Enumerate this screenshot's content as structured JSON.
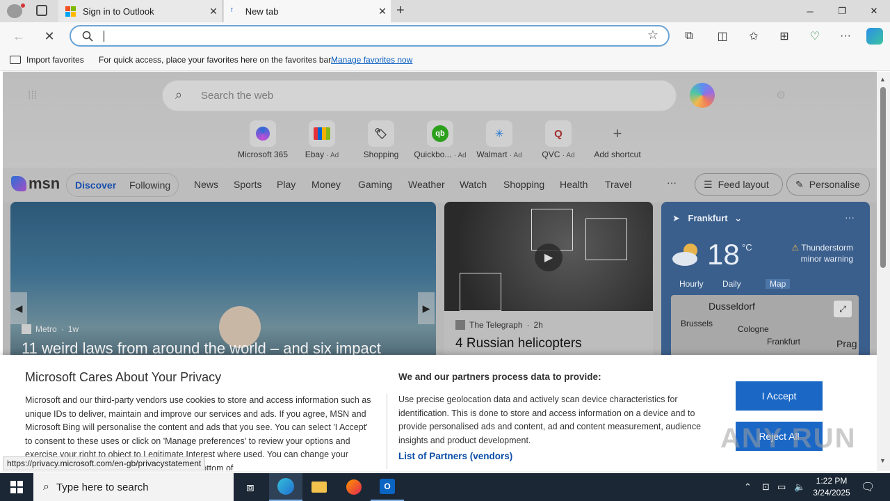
{
  "browser": {
    "tabs": [
      {
        "title": "Sign in to Outlook",
        "active": false
      },
      {
        "title": "New tab",
        "active": true
      }
    ],
    "address": {
      "value": "",
      "placeholder": ""
    },
    "favorites_bar": {
      "import_label": "Import favorites",
      "message": "For quick access, place your favorites here on the favorites bar.",
      "manage_link": "Manage favorites now"
    }
  },
  "newtab": {
    "search_placeholder": "Search the web",
    "shortcuts": [
      {
        "label": "Microsoft 365",
        "ad": ""
      },
      {
        "label": "Ebay",
        "ad": "· Ad"
      },
      {
        "label": "Shopping",
        "ad": ""
      },
      {
        "label": "Quickbo...",
        "ad": "· Ad"
      },
      {
        "label": "Walmart",
        "ad": "· Ad"
      },
      {
        "label": "QVC",
        "ad": "· Ad"
      },
      {
        "label": "Add shortcut",
        "ad": ""
      }
    ],
    "msn": {
      "logo": "msn",
      "pills": [
        "Discover",
        "Following"
      ],
      "nav": [
        "News",
        "Sports",
        "Play",
        "Money",
        "Gaming",
        "Weather",
        "Watch",
        "Shopping",
        "Health",
        "Travel"
      ],
      "more": "···",
      "feed_layout": "Feed layout",
      "personalise": "Personalise"
    },
    "cards": {
      "main": {
        "source": "Metro",
        "age": "1w",
        "headline": "11 weird laws from around the world – and six impact"
      },
      "video": {
        "source": "The Telegraph",
        "age": "2h",
        "headline": "4 Russian helicopters"
      },
      "weather": {
        "location": "Frankfurt",
        "temp": "18",
        "unit": "°C",
        "warning_line1": "Thunderstorm",
        "warning_line2": "minor warning",
        "tabs": [
          "Hourly",
          "Daily",
          "Map"
        ],
        "map_labels": [
          "Dusseldorf",
          "Brussels",
          "Cologne",
          "Frankfurt",
          "Prag"
        ]
      }
    }
  },
  "privacy": {
    "title": "Microsoft Cares About Your Privacy",
    "body": "Microsoft and our third-party vendors use cookies to store and access information such as unique IDs to deliver, maintain and improve our services and ads. If you agree, MSN and Microsoft Bing will personalise the content and ads that you see. You can select 'I Accept' to consent to these uses or click on 'Manage preferences' to review your options and exercise your right to object to Legitimate Interest where used. You can change your selection under 'Manage Preferences' at the bottom of",
    "right_title": "We and our partners process data to provide:",
    "right_body": "Use precise geolocation data and actively scan device characteristics for identification. This is done to store and access information on a device and to provide personalised ads and content, ad and content measurement, audience insights and product development.",
    "partners_link": "List of Partners (vendors)",
    "accept": "I Accept",
    "reject": "Reject All"
  },
  "status_url": "https://privacy.microsoft.com/en-gb/privacystatement",
  "watermark": "ANY RUN",
  "taskbar": {
    "search_placeholder": "Type here to search",
    "time": "1:22 PM",
    "date": "3/24/2025"
  }
}
